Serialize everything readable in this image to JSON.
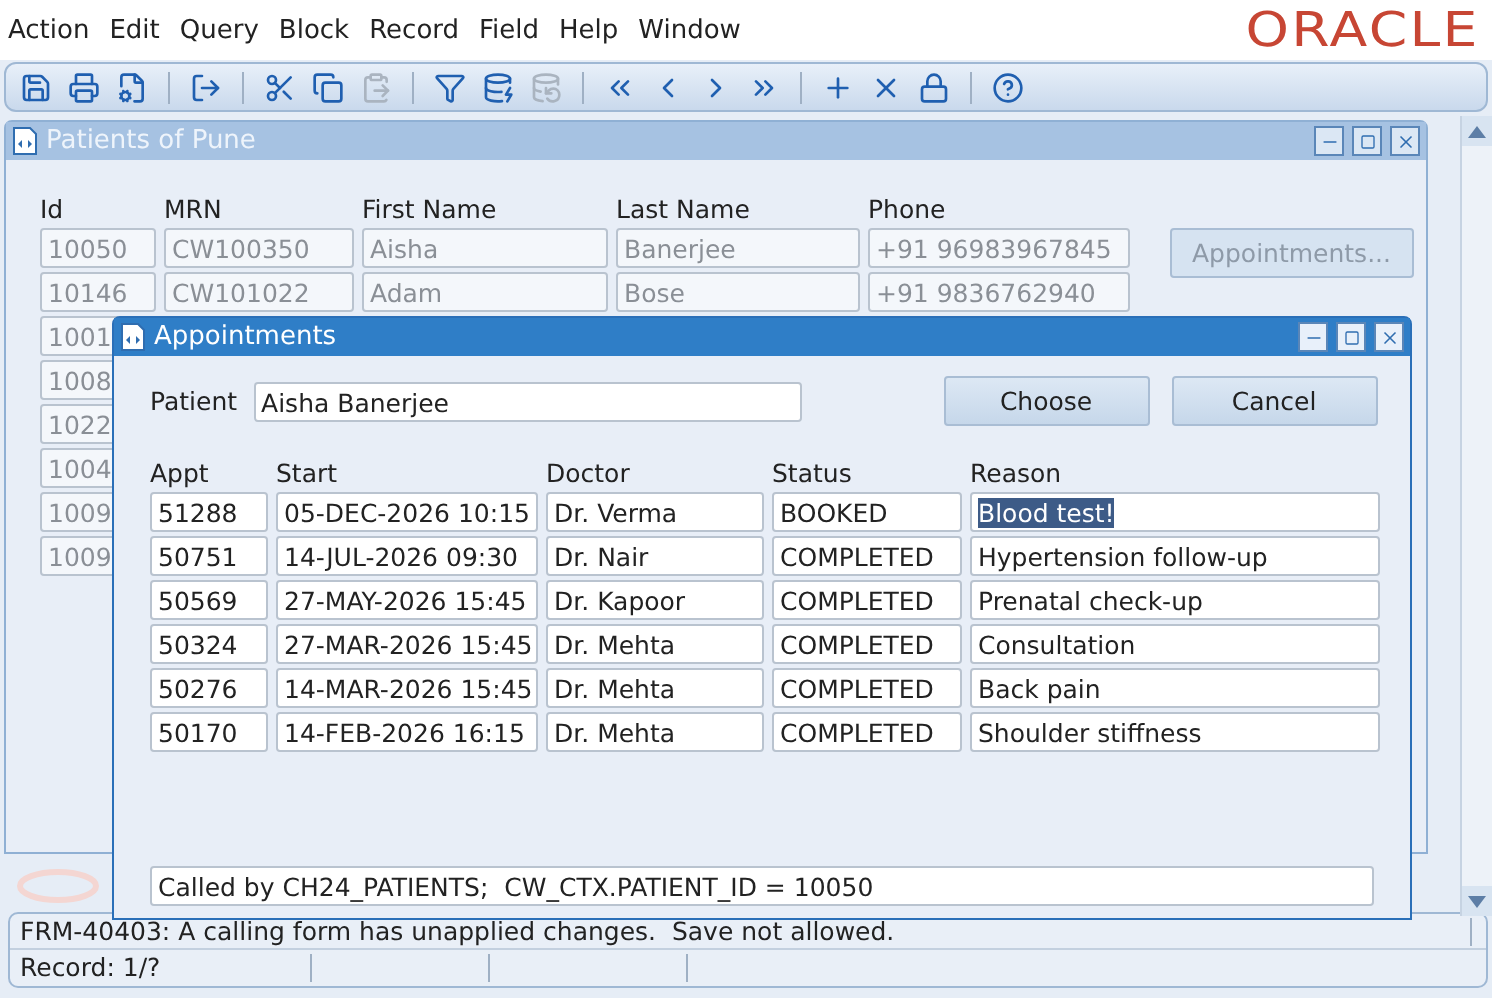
{
  "menu": [
    "Action",
    "Edit",
    "Query",
    "Block",
    "Record",
    "Field",
    "Help",
    "Window"
  ],
  "logo": "ORACLE",
  "toolbar": [
    [
      {
        "disabled": false
      },
      {
        "disabled": false
      },
      {
        "disabled": false
      }
    ],
    [
      {
        "disabled": false
      }
    ],
    [
      {
        "disabled": false
      },
      {
        "disabled": false
      },
      {
        "disabled": true
      }
    ],
    [
      {
        "disabled": false
      },
      {
        "disabled": false
      },
      {
        "disabled": true
      }
    ],
    [
      {
        "disabled": false
      },
      {
        "disabled": false
      },
      {
        "disabled": false
      },
      {
        "disabled": false
      }
    ],
    [
      {
        "disabled": false
      },
      {
        "disabled": false
      },
      {
        "disabled": false
      }
    ],
    [
      {
        "disabled": false
      }
    ]
  ],
  "patients_window": {
    "title": "Patients of Pune",
    "columns": [
      "Id",
      "MRN",
      "First Name",
      "Last Name",
      "Phone"
    ],
    "rows": [
      [
        "10050",
        "CW100350",
        "Aisha",
        "Banerjee",
        "+91 96983967845"
      ],
      [
        "10146",
        "CW101022",
        "Adam",
        "Bose",
        "+91 9836762940"
      ],
      [
        "1001"
      ],
      [
        "1008"
      ],
      [
        "1022"
      ],
      [
        "1004"
      ],
      [
        "1009"
      ],
      [
        "1009"
      ]
    ],
    "button": {
      "label": "Appointments...",
      "disabled": true
    }
  },
  "appointments_dialog": {
    "title": "Appointments",
    "patient_label": "Patient",
    "patient_value": "Aisha Banerjee",
    "buttons": [
      "Choose",
      "Cancel"
    ],
    "columns": [
      "Appt",
      "Start",
      "Doctor",
      "Status",
      "Reason"
    ],
    "rows": [
      {
        "appt": "51288",
        "start": "05-DEC-2026 10:15",
        "doctor": "Dr. Verma",
        "status": "BOOKED",
        "reason": "Blood test!",
        "selected": true
      },
      {
        "appt": "50751",
        "start": "14-JUL-2026 09:30",
        "doctor": "Dr. Nair",
        "status": "COMPLETED",
        "reason": "Hypertension follow-up",
        "selected": false
      },
      {
        "appt": "50569",
        "start": "27-MAY-2026 15:45",
        "doctor": "Dr. Kapoor",
        "status": "COMPLETED",
        "reason": "Prenatal check-up",
        "selected": false
      },
      {
        "appt": "50324",
        "start": "27-MAR-2026 15:45",
        "doctor": "Dr. Mehta",
        "status": "COMPLETED",
        "reason": "Consultation",
        "selected": false
      },
      {
        "appt": "50276",
        "start": "14-MAR-2026 15:45",
        "doctor": "Dr. Mehta",
        "status": "COMPLETED",
        "reason": "Back pain",
        "selected": false
      },
      {
        "appt": "50170",
        "start": "14-FEB-2026 16:15",
        "doctor": "Dr. Mehta",
        "status": "COMPLETED",
        "reason": "Shoulder stiffness",
        "selected": false
      }
    ],
    "footer": "Called by CH24_PATIENTS;  CW_CTX.PATIENT_ID = 10050"
  },
  "status_bar": {
    "message": "FRM-40403: A calling form has unapplied changes.  Save not allowed.",
    "record": "Record: 1/?"
  }
}
